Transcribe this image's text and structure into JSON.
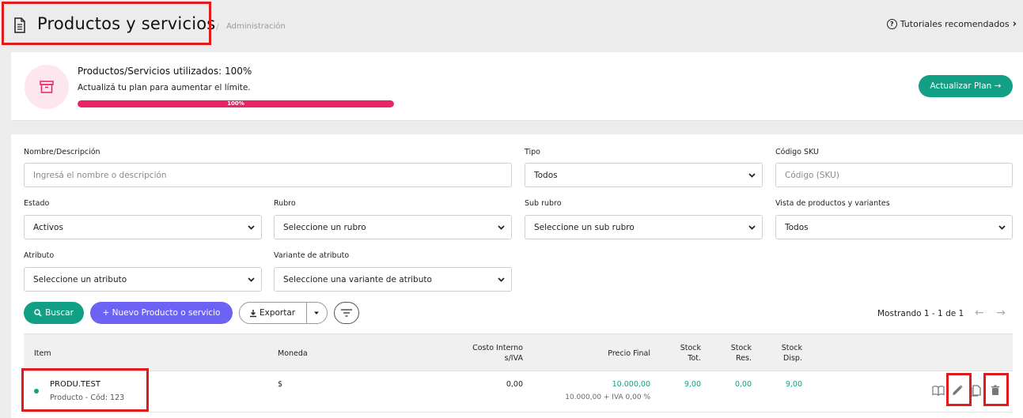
{
  "header": {
    "title": "Productos y servicios",
    "separator": "/",
    "breadcrumb": "Administración",
    "tutorials_label": "Tutoriales recomendados",
    "tutorials_icon": "question-circle-icon"
  },
  "plan": {
    "title": "Productos/Servicios utilizados: 100%",
    "subtitle": "Actualizá tu plan para aumentar el límite.",
    "progress_value": 100,
    "progress_label": "100%",
    "update_button": "Actualizar Plan →",
    "icon": "archive-box-icon",
    "accent": "#e72468"
  },
  "filters": {
    "name_label": "Nombre/Descripción",
    "name_placeholder": "Ingresá el nombre o descripción",
    "tipo_label": "Tipo",
    "tipo_value": "Todos",
    "sku_label": "Código SKU",
    "sku_placeholder": "Código (SKU)",
    "estado_label": "Estado",
    "estado_value": "Activos",
    "rubro_label": "Rubro",
    "rubro_value": "Seleccione un rubro",
    "subrubro_label": "Sub rubro",
    "subrubro_value": "Seleccione un sub rubro",
    "vista_label": "Vista de productos y variantes",
    "vista_value": "Todos",
    "atributo_label": "Atributo",
    "atributo_value": "Seleccione un atributo",
    "variante_label": "Variante de atributo",
    "variante_value": "Seleccione una variante de atributo"
  },
  "actions": {
    "search_label": "Buscar",
    "new_label": "+ Nuevo Producto o servicio",
    "export_label": "Exportar",
    "paging_text": "Mostrando 1 - 1 de 1"
  },
  "table": {
    "headers": {
      "item": "Item",
      "moneda": "Moneda",
      "costo_1": "Costo Interno",
      "costo_2": "s/IVA",
      "precio": "Precio Final",
      "stock_tot_1": "Stock",
      "stock_tot_2": "Tot.",
      "stock_res_1": "Stock",
      "stock_res_2": "Res.",
      "stock_disp_1": "Stock",
      "stock_disp_2": "Disp."
    },
    "rows": [
      {
        "name": "PRODU.TEST",
        "detail": "Producto - Cód: 123",
        "moneda": "$",
        "costo": "0,00",
        "precio": "10.000,00",
        "precio_detalle": "10.000,00 + IVA 0,00 %",
        "stock_tot": "9,00",
        "stock_res": "0,00",
        "stock_disp": "9,00"
      }
    ]
  },
  "colors": {
    "primary_green": "#11a085",
    "purple": "#6c63f5",
    "highlight_red": "#e01b1b"
  }
}
